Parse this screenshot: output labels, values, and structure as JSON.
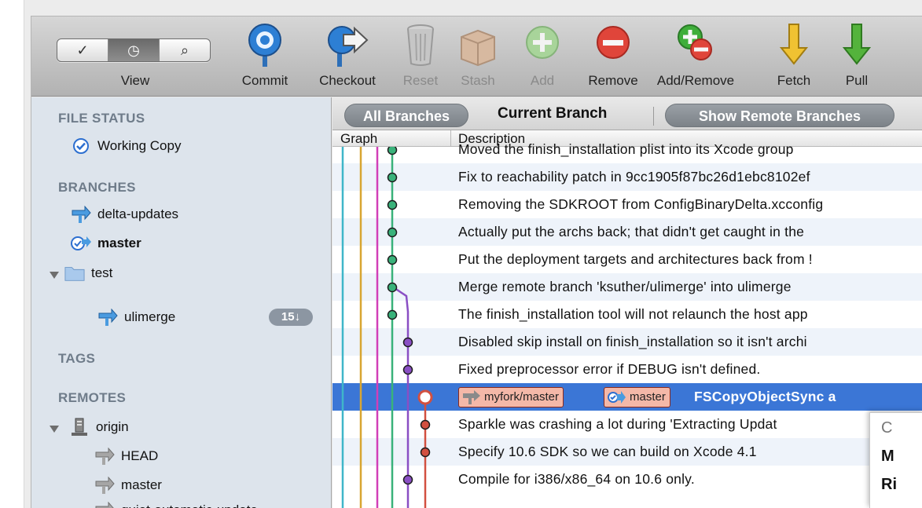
{
  "toolbar": {
    "view_label": "View",
    "view_segments": [
      "✓",
      "◷",
      "⌕"
    ],
    "items": [
      {
        "label": "Commit",
        "icon": "commit-icon",
        "enabled": true
      },
      {
        "label": "Checkout",
        "icon": "checkout-icon",
        "enabled": true
      },
      {
        "label": "Reset",
        "icon": "reset-icon",
        "enabled": false
      },
      {
        "label": "Stash",
        "icon": "stash-icon",
        "enabled": false
      },
      {
        "label": "Add",
        "icon": "add-icon",
        "enabled": false
      },
      {
        "label": "Remove",
        "icon": "remove-icon",
        "enabled": true
      },
      {
        "label": "Add/Remove",
        "icon": "add-remove-icon",
        "enabled": true
      },
      {
        "label": "Fetch",
        "icon": "fetch-icon",
        "enabled": true
      },
      {
        "label": "Pull",
        "icon": "pull-icon",
        "enabled": true
      }
    ]
  },
  "sidebar": {
    "file_status": {
      "heading": "FILE STATUS",
      "working_copy": "Working Copy"
    },
    "branches": {
      "heading": "BRANCHES",
      "items": [
        "delta-updates",
        "master"
      ],
      "folder": {
        "label": "test",
        "children": [
          {
            "label": "ulimerge",
            "badge": "15↓"
          }
        ]
      }
    },
    "tags": {
      "heading": "TAGS"
    },
    "remotes": {
      "heading": "REMOTES",
      "origin": {
        "label": "origin",
        "children": [
          "HEAD",
          "master",
          "quiet-automatic-update"
        ]
      }
    }
  },
  "main": {
    "filter": {
      "all_branches": "All Branches",
      "current_branch": "Current Branch",
      "show_remote": "Show Remote Branches"
    },
    "columns": {
      "graph": "Graph",
      "description": "Description"
    },
    "commits": [
      {
        "description": "Moved the finish_installation plist into its Xcode group"
      },
      {
        "description": "Fix to reachability patch in 9cc1905f87bc26d1ebc8102ef"
      },
      {
        "description": "Removing the SDKROOT from ConfigBinaryDelta.xcconfig"
      },
      {
        "description": "Actually put the archs back; that didn't get caught in the"
      },
      {
        "description": "Put the deployment targets and architectures back from !"
      },
      {
        "description": "Merge remote branch 'ksuther/ulimerge' into ulimerge"
      },
      {
        "description": "The finish_installation tool will not relaunch the host app"
      },
      {
        "description": "Disabled skip install on finish_installation so it isn't archi"
      },
      {
        "description": "Fixed preprocessor error if DEBUG isn't defined."
      },
      {
        "description": "FSCopyObjectSync a",
        "refs": [
          "myfork/master",
          "master"
        ],
        "selected": true
      },
      {
        "description": "Sparkle was crashing a lot during 'Extracting Updat"
      },
      {
        "description": "Specify 10.6 SDK so we can build on Xcode 4.1"
      },
      {
        "description": "Compile for i386/x86_64 on 10.6 only."
      }
    ]
  },
  "popover": {
    "lines": [
      "C",
      "M",
      "Ri"
    ]
  },
  "colors": {
    "lane_cyan": "#3fb6c9",
    "lane_gold": "#d8a531",
    "lane_magenta": "#d13fb8",
    "lane_green": "#39b27a",
    "lane_purple": "#8a4fc4",
    "lane_red": "#d25040",
    "selection": "#3b76d6"
  }
}
